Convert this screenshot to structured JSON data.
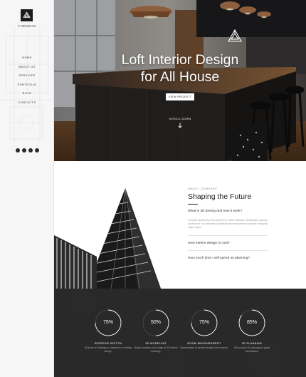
{
  "brand": {
    "name": "THESEUS"
  },
  "nav": {
    "items": [
      {
        "label": "HOME"
      },
      {
        "label": "ABOUT US"
      },
      {
        "label": "SERVICES"
      },
      {
        "label": "PORTFOLIO"
      },
      {
        "label": "BLOG"
      },
      {
        "label": "CONTACTS"
      }
    ]
  },
  "social": [
    "twitter-icon",
    "facebook-icon",
    "linkedin-icon",
    "instagram-icon"
  ],
  "hero": {
    "title_line1": "Loft Interior Design",
    "title_line2": "for All House",
    "button_label": "VIEW PROJECT",
    "scroll_label": "SCROLL DOWN"
  },
  "about": {
    "eyebrow": "ABOUT COMPANY",
    "heading": "Shaping the Future",
    "faq": [
      {
        "question": "What is 3D desing and how it work?",
        "answer": "The basic philosophy of our studio is to create individual, aesthetically stunning solutions for our customers by lightning-fast development of projects employing unique styles."
      },
      {
        "question": "How interior design is cost?"
      },
      {
        "question": "How much time I will spend on planning?"
      }
    ]
  },
  "stats": [
    {
      "percent": "75%",
      "value": 0.75,
      "title": "INTERIOR SKETCH",
      "desc": "All kinds of buildings in cinematic or working design."
    },
    {
      "percent": "50%",
      "value": 0.5,
      "title": "3D MODELING",
      "desc": "Studio provides a full range of 3D interior modeling."
    },
    {
      "percent": "75%",
      "value": 0.75,
      "title": "ROOM MEASUREMENT",
      "desc": "Development of perfect design of the project."
    },
    {
      "percent": "85%",
      "value": 0.85,
      "title": "3D PLANNING",
      "desc": "We provide 3D planning for great visualization."
    }
  ],
  "colors": {
    "dark": "#262626",
    "accent": "#ffffff",
    "muted": "#a8a8a8"
  }
}
